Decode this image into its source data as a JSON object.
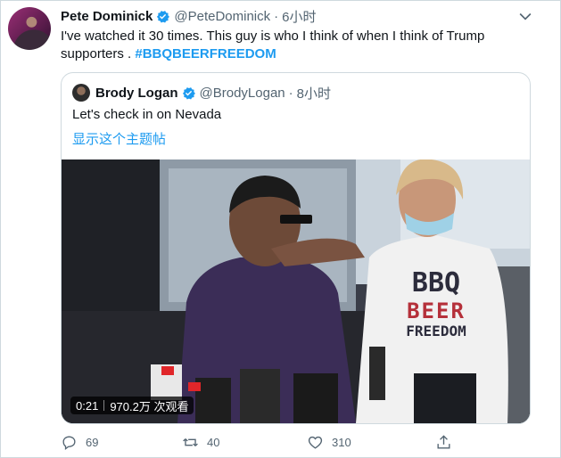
{
  "tweet": {
    "author_name": "Pete Dominick",
    "author_handle": "@PeteDominick",
    "time": "6小时",
    "text": "I've watched it 30 times. This guy is who I think of when I think of Trump supporters . ",
    "hashtag": "#BBQBEERFREEDOM"
  },
  "quote": {
    "author_name": "Brody Logan",
    "author_handle": "@BrodyLogan",
    "time": "8小时",
    "text": "Let's check in on Nevada",
    "show_thread": "显示这个主题帖",
    "video": {
      "duration": "0:21",
      "views": "970.2万 次观看",
      "shirt_lines": [
        "BBQ",
        "BEER",
        "FREEDOM"
      ]
    }
  },
  "actions": {
    "replies": "69",
    "retweets": "40",
    "likes": "310"
  },
  "icons": {
    "verified": "verified-badge-icon",
    "more": "chevron-down-icon",
    "reply": "reply-icon",
    "retweet": "retweet-icon",
    "like": "heart-icon",
    "share": "share-icon"
  },
  "colors": {
    "accent": "#1d9bf0",
    "secondary_text": "#536471",
    "border": "#cfd9de"
  }
}
